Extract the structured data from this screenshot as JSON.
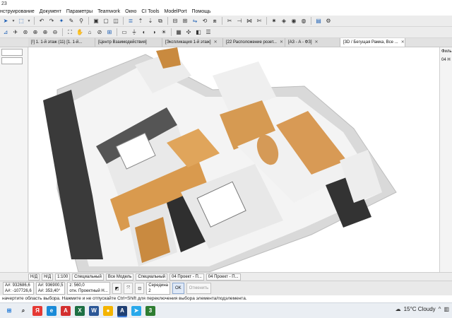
{
  "window": {
    "title_fragment": "23"
  },
  "menu": [
    "нструирование",
    "Документ",
    "Параметры",
    "Teamwork",
    "Окно",
    "CI Tools",
    "ModelPort",
    "Помощь"
  ],
  "toolbar1_icons": [
    "arrow-tool-icon",
    "marquee-icon",
    "arrow-left-icon",
    "arrow-right-icon",
    "magic-wand-icon",
    "eyedropper-icon",
    "syringe-icon",
    "group-icon",
    "ungroup-icon",
    "suspend-group-icon",
    "layer-icon",
    "level-up-icon",
    "level-down-icon",
    "bring-front-icon",
    "align-icon",
    "distribute-icon",
    "mirror-icon",
    "rotate-icon",
    "offset-icon",
    "split-icon",
    "adjust-icon",
    "intersect-icon",
    "trim-icon",
    "explode-icon",
    "3d-view-icon",
    "camera-icon",
    "render-icon",
    "layout-icon",
    "settings-icon"
  ],
  "toolbar2_icons": [
    "2d-3d-icon",
    "walk-icon",
    "orbit-icon",
    "navigate-icon",
    "zoom-in-icon",
    "zoom-out-icon",
    "fit-window-icon",
    "pan-icon",
    "floor-icon",
    "section-icon",
    "elevation-icon",
    "marquee-slab-icon",
    "filter-icon",
    "render-mode-icon",
    "shadow-icon",
    "sun-icon",
    "background-icon",
    "explode-view-icon",
    "cutaway-icon",
    "layers-icon"
  ],
  "tabs": [
    {
      "label": "[!] 1. 1-й этаж (11) [1. 1-й..."
    },
    {
      "label": "[Центр Взаимодействия]"
    },
    {
      "label": "[Экспликация 1-й этаж]"
    },
    {
      "label": "[22 Расположение розет..."
    },
    {
      "label": "[А3 - А - ФЗ]"
    },
    {
      "label": "[3D / Бегущая Рамка, Все ..."
    }
  ],
  "left_panel": {
    "field1": "",
    "field2": ""
  },
  "right_panel": {
    "label1": "Филь",
    "value1": "04 Н"
  },
  "navbar": {
    "zoom_value": "1:100",
    "structure": "Специальный",
    "model": "Все Модель",
    "special": "Специальный",
    "project1": "04 Проект - П...",
    "project2": "04 Проект - П...",
    "nd1": "Н/Д",
    "nd2": "Н/Д"
  },
  "infobox": {
    "ax_label": "А#: 932686,6",
    "ay_label": "А#: -107726,6",
    "bx_label": "А#: 936900,5",
    "by_label": "А#: 353,40°",
    "z_label": "z: 560,0",
    "ref_label": "отн. Проектный Н...",
    "middle_label": "Середина",
    "middle_value": "2",
    "ok_label": "OK",
    "cancel_label": "Отменить"
  },
  "status": {
    "text": "начертите область выбора. Нажмите и не отпускайте Ctrl+Shift для переключения выбора элемента/подэлемента."
  },
  "tray": {
    "weather": "15°C Cloudy"
  },
  "taskbar_icons": [
    "windows-icon",
    "search-icon",
    "yandex-icon",
    "edge-icon",
    "acrobat-icon",
    "excel-icon",
    "word-icon",
    "chrome-icon",
    "archicad-icon",
    "telegram-icon",
    "app-icon"
  ]
}
